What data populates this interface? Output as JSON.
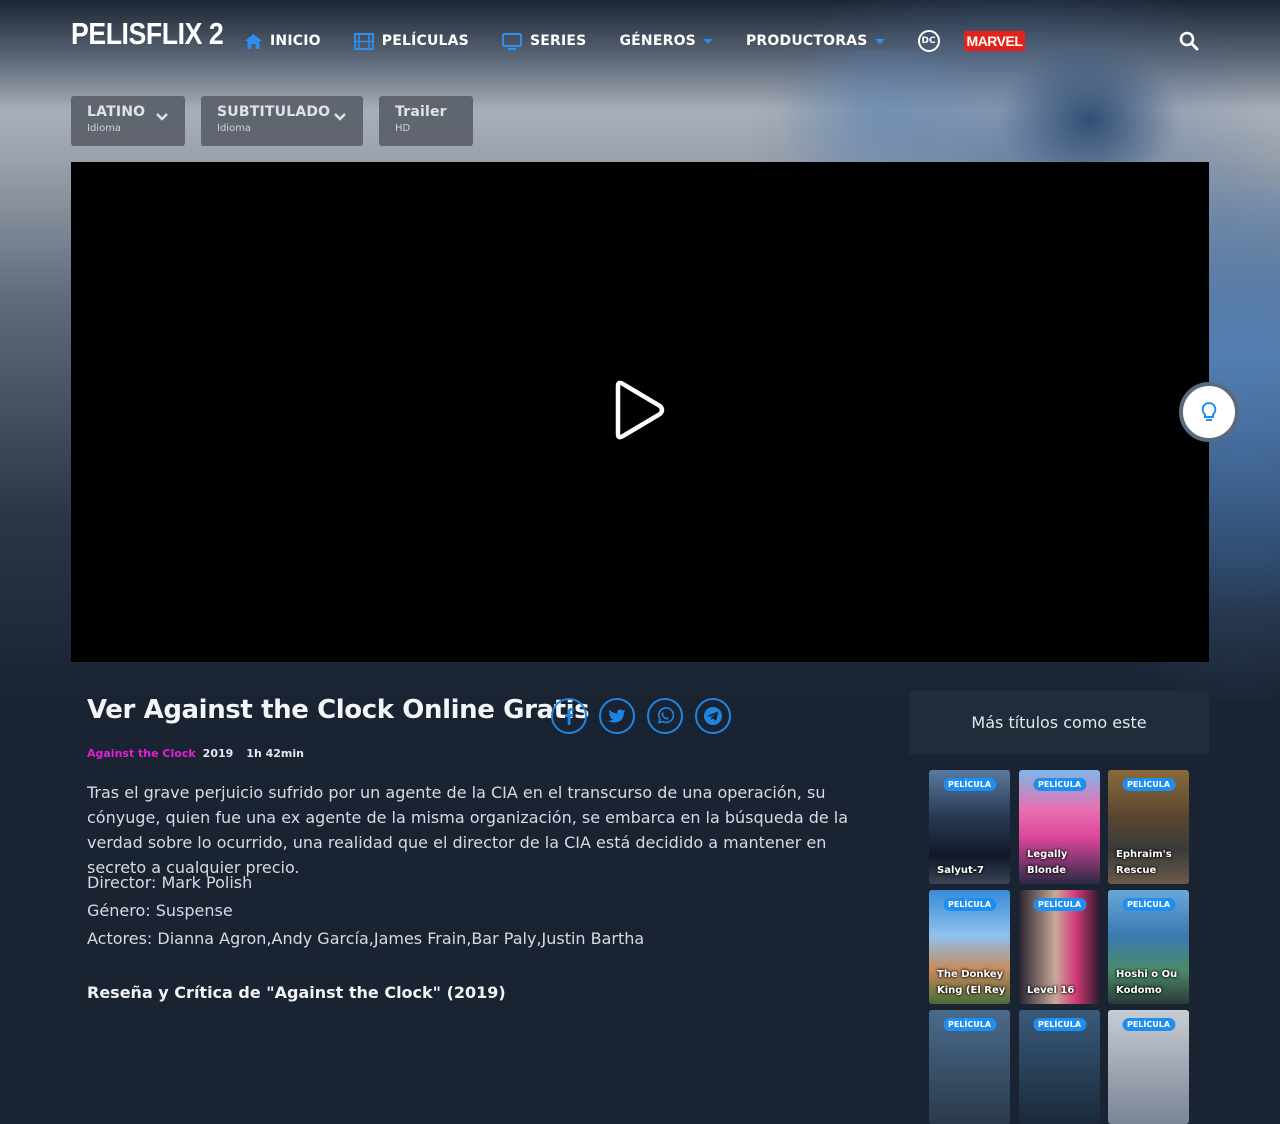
{
  "site": {
    "logo": "PELISFLIX 2"
  },
  "nav": {
    "items": [
      {
        "label": "INICIO",
        "icon": "home-icon"
      },
      {
        "label": "PELÍCULAS",
        "icon": "film-icon"
      },
      {
        "label": "SERIES",
        "icon": "tv-icon"
      },
      {
        "label": "GÉNEROS",
        "icon": "caret-down-icon"
      },
      {
        "label": "PRODUCTORAS",
        "icon": "caret-down-icon"
      }
    ],
    "dc": "DC",
    "marvel": "MARVEL"
  },
  "options": [
    {
      "title": "LATINO",
      "sub": "Idioma"
    },
    {
      "title": "SUBTITULADO",
      "sub": "Idioma"
    },
    {
      "title": "Trailer",
      "sub": "HD"
    }
  ],
  "player": {
    "play_icon": "play-icon",
    "light_icon": "lightbulb-icon"
  },
  "movie": {
    "heading": "Ver Against the Clock Online Gratis",
    "original_title": "Against the Clock",
    "year": "2019",
    "duration": "1h 42min",
    "synopsis": "Tras el grave perjuicio sufrido por un agente de la CIA en el transcurso de una operación, su cónyuge, quien fue una ex agente de la misma organización, se embarca en la búsqueda de la verdad sobre lo ocurrido, una realidad que el director de la CIA está decidido a mantener en secreto a cualquier precio.",
    "director": "Director: Mark Polish",
    "genre": "Género: Suspense",
    "actors": "Actores: Dianna Agron,Andy García,James Frain,Bar Paly,Justin Bartha",
    "review_heading": "Reseña y Crítica de \"Against the Clock\" (2019)"
  },
  "share": [
    "facebook-icon",
    "twitter-icon",
    "whatsapp-icon",
    "telegram-icon"
  ],
  "sidebar": {
    "heading": "Más títulos como este",
    "cards": [
      {
        "badge": "PELÍCULA",
        "title": "Salyut-7"
      },
      {
        "badge": "PELÍCULA",
        "title": "Legally Blonde"
      },
      {
        "badge": "PELÍCULA",
        "title": "Ephraim's Rescue"
      },
      {
        "badge": "PELÍCULA",
        "title": "The Donkey King (El Rey"
      },
      {
        "badge": "PELÍCULA",
        "title": "Level 16"
      },
      {
        "badge": "PELÍCULA",
        "title": "Hoshi o Ou Kodomo"
      },
      {
        "badge": "PELÍCULA",
        "title": ""
      },
      {
        "badge": "PELÍCULA",
        "title": ""
      },
      {
        "badge": "PELÍCULA",
        "title": ""
      }
    ]
  },
  "colors": {
    "accent": "#1f8ef1",
    "meta_pink": "#e21fd6",
    "background": "#1a2332"
  }
}
